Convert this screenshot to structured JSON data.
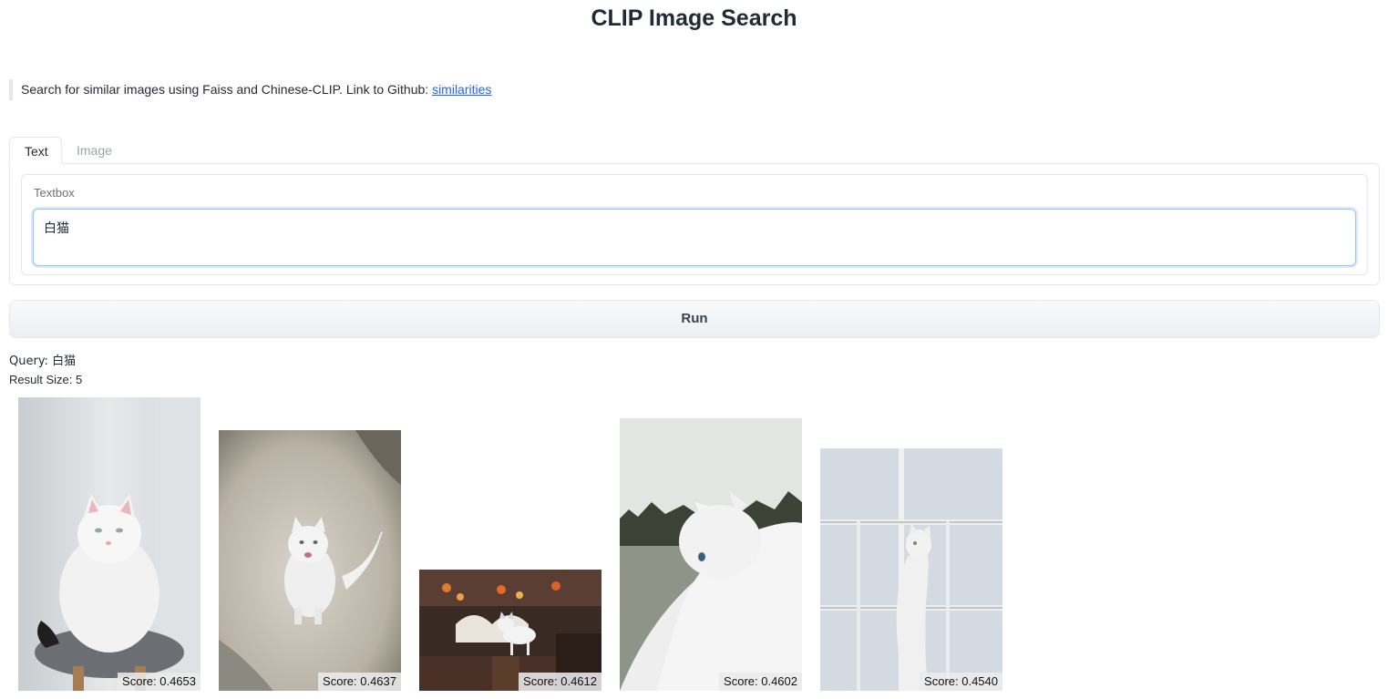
{
  "header": {
    "title": "CLIP Image Search"
  },
  "description": {
    "text": "Search for similar images using Faiss and Chinese-CLIP. Link to Github: ",
    "link_label": "similarities"
  },
  "tabs": [
    {
      "label": "Text",
      "active": true
    },
    {
      "label": "Image",
      "active": false
    }
  ],
  "textbox": {
    "label": "Textbox",
    "value": "白猫"
  },
  "run_button": {
    "label": "Run"
  },
  "results": {
    "query_line": "Query: 白猫",
    "size_line": "Result Size: 5",
    "items": [
      {
        "image_icon": "white-cat-on-stool-photo",
        "score": "Score: 0.4653"
      },
      {
        "image_icon": "white-cat-sitting-on-ground-photo",
        "score": "Score: 0.4637"
      },
      {
        "image_icon": "white-cat-on-bench-with-flowers-photo",
        "score": "Score: 0.4612"
      },
      {
        "image_icon": "white-cat-profile-near-trees-photo",
        "score": "Score: 0.4602"
      },
      {
        "image_icon": "white-cat-behind-window-photo",
        "score": "Score: 0.4540"
      }
    ]
  },
  "colors": {
    "link": "#2563eb",
    "focus_border": "#93c5fd",
    "border": "#e5e7eb"
  }
}
